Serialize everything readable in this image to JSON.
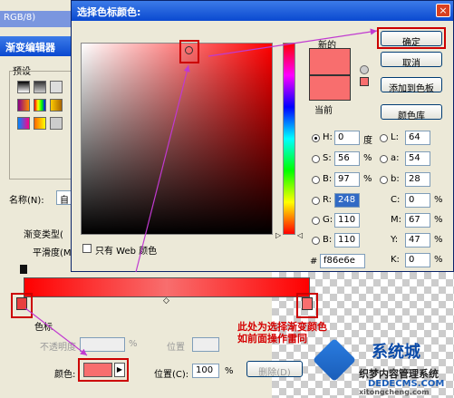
{
  "background": {
    "doc_tab": "RGB/8)",
    "gradient_editor": {
      "title": "渐变编辑器",
      "presets_label": "预设",
      "name_label": "名称(N):",
      "name_value": "自",
      "gradient_type_label": "渐变类型(",
      "smoothness_label": "平滑度(M",
      "stops_label": "色标",
      "opacity_label": "不透明度",
      "location_label_top": "位置",
      "color_label": "颜色:",
      "location_label": "位置(C):",
      "location_value": "100",
      "percent": "%",
      "delete_label": "删除(D)",
      "annotation": "此处为选择渐变颜色\n如前面操作雷同"
    }
  },
  "dialog": {
    "title": "选择色标颜色:",
    "new_label": "新的",
    "current_label": "当前",
    "ok_button": "确定",
    "cancel_button": "取消",
    "add_swatch_button": "添加到色板",
    "color_library_button": "颜色库",
    "web_only_label": "只有 Web 颜色",
    "fields": {
      "H": {
        "label": "H:",
        "value": "0",
        "unit": "度"
      },
      "S": {
        "label": "S:",
        "value": "56",
        "unit": "%"
      },
      "B": {
        "label": "B:",
        "value": "97",
        "unit": "%"
      },
      "R": {
        "label": "R:",
        "value": "248"
      },
      "G": {
        "label": "G:",
        "value": "110"
      },
      "Bb": {
        "label": "B:",
        "value": "110"
      },
      "L": {
        "label": "L:",
        "value": "64"
      },
      "a": {
        "label": "a:",
        "value": "54"
      },
      "b": {
        "label": "b:",
        "value": "28"
      },
      "C": {
        "label": "C:",
        "value": "0",
        "unit": "%"
      },
      "M": {
        "label": "M:",
        "value": "67",
        "unit": "%"
      },
      "Y": {
        "label": "Y:",
        "value": "47",
        "unit": "%"
      },
      "K": {
        "label": "K:",
        "value": "0",
        "unit": "%"
      }
    },
    "hex_label": "#",
    "hex_value": "f86e6e"
  },
  "watermark": {
    "line1": "系统城",
    "line2": "织梦内容管理系统",
    "line3": "DEDECMS.COM",
    "line4": "xitongcheng.com"
  },
  "colors": {
    "selected": "#f86e6e",
    "accent": "#0a49d0",
    "annotation": "#d40000"
  }
}
